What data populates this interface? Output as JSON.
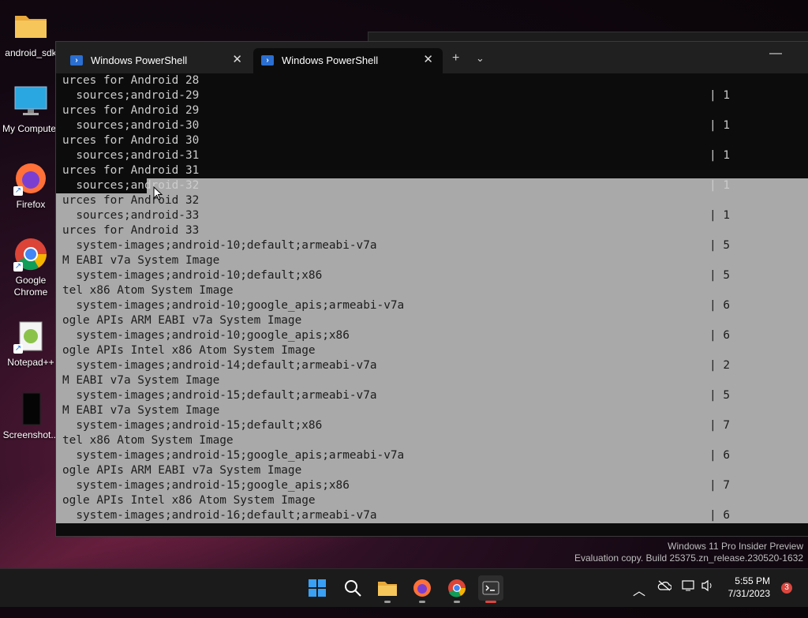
{
  "desktop": {
    "icons": [
      {
        "label": "android_sdk",
        "icon": "folder-icon"
      },
      {
        "label": "My Computer",
        "icon": "monitor-icon"
      },
      {
        "label": "Firefox",
        "icon": "firefox-icon"
      },
      {
        "label": "Google Chrome",
        "icon": "chrome-icon"
      },
      {
        "label": "Notepad++",
        "icon": "notepadpp-icon"
      },
      {
        "label": "Screenshot...",
        "icon": "screenshot-icon"
      }
    ]
  },
  "terminal": {
    "tabs": [
      {
        "title": "Windows PowerShell",
        "active": false
      },
      {
        "title": "Windows PowerShell",
        "active": true
      }
    ],
    "new_tab_label": "+",
    "dropdown_label": "⌄",
    "minimize_label": "—",
    "lines": [
      {
        "text": "urces for Android 28",
        "col": "",
        "sel": "none"
      },
      {
        "text": "  sources;android-29",
        "col": "| 1",
        "sel": "none"
      },
      {
        "text": "urces for Android 29",
        "col": "",
        "sel": "none"
      },
      {
        "text": "  sources;android-30",
        "col": "| 1",
        "sel": "none"
      },
      {
        "text": "urces for Android 30",
        "col": "",
        "sel": "none"
      },
      {
        "text": "  sources;android-31",
        "col": "| 1",
        "sel": "none"
      },
      {
        "text": "urces for Android 31",
        "col": "",
        "sel": "none"
      },
      {
        "text": "  sources;android-32",
        "col": "| 1",
        "sel": "partial"
      },
      {
        "text": "urces for Android 32",
        "col": "",
        "sel": "full"
      },
      {
        "text": "  sources;android-33",
        "col": "| 1",
        "sel": "full"
      },
      {
        "text": "urces for Android 33",
        "col": "",
        "sel": "full"
      },
      {
        "text": "  system-images;android-10;default;armeabi-v7a",
        "col": "| 5",
        "sel": "full"
      },
      {
        "text": "M EABI v7a System Image",
        "col": "",
        "sel": "full"
      },
      {
        "text": "  system-images;android-10;default;x86",
        "col": "| 5",
        "sel": "full"
      },
      {
        "text": "tel x86 Atom System Image",
        "col": "",
        "sel": "full"
      },
      {
        "text": "  system-images;android-10;google_apis;armeabi-v7a",
        "col": "| 6",
        "sel": "full"
      },
      {
        "text": "ogle APIs ARM EABI v7a System Image",
        "col": "",
        "sel": "full"
      },
      {
        "text": "  system-images;android-10;google_apis;x86",
        "col": "| 6",
        "sel": "full"
      },
      {
        "text": "ogle APIs Intel x86 Atom System Image",
        "col": "",
        "sel": "full"
      },
      {
        "text": "  system-images;android-14;default;armeabi-v7a",
        "col": "| 2",
        "sel": "full"
      },
      {
        "text": "M EABI v7a System Image",
        "col": "",
        "sel": "full"
      },
      {
        "text": "  system-images;android-15;default;armeabi-v7a",
        "col": "| 5",
        "sel": "full"
      },
      {
        "text": "M EABI v7a System Image",
        "col": "",
        "sel": "full"
      },
      {
        "text": "  system-images;android-15;default;x86",
        "col": "| 7",
        "sel": "full"
      },
      {
        "text": "tel x86 Atom System Image",
        "col": "",
        "sel": "full"
      },
      {
        "text": "  system-images;android-15;google_apis;armeabi-v7a",
        "col": "| 6",
        "sel": "full"
      },
      {
        "text": "ogle APIs ARM EABI v7a System Image",
        "col": "",
        "sel": "full"
      },
      {
        "text": "  system-images;android-15;google_apis;x86",
        "col": "| 7",
        "sel": "full"
      },
      {
        "text": "ogle APIs Intel x86 Atom System Image",
        "col": "",
        "sel": "full"
      },
      {
        "text": "  system-images;android-16;default;armeabi-v7a",
        "col": "| 6",
        "sel": "full"
      }
    ]
  },
  "watermark": {
    "line1": "Windows 11 Pro Insider Preview",
    "line2": "Evaluation copy. Build 25375.zn_release.230520-1632"
  },
  "taskbar": {
    "apps": [
      "start-icon",
      "search-icon",
      "file-explorer-icon",
      "firefox-icon",
      "chrome-icon",
      "terminal-icon"
    ],
    "time": "5:55 PM",
    "date": "7/31/2023",
    "notification_count": "3"
  },
  "colors": {
    "selection": "#a9a9a9",
    "terminal_bg": "#0c0c0c",
    "tab_bar": "#202020"
  }
}
